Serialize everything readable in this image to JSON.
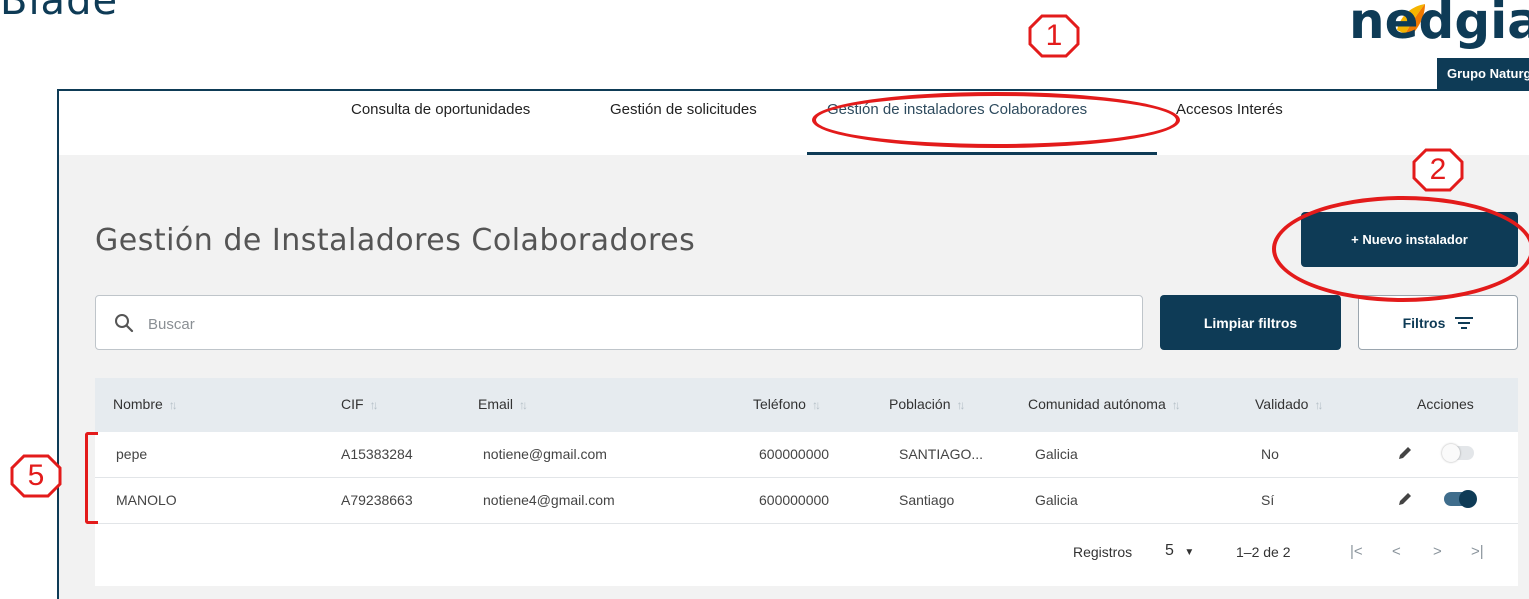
{
  "header": {
    "cut_word": "Blade"
  },
  "logo": {
    "name": "nedgia",
    "subtitle": "Grupo Naturgy",
    "colors": {
      "navy": "#0e3b56",
      "yellow": "#f5b400",
      "orange": "#f07800"
    }
  },
  "nav": {
    "items": [
      {
        "label": "Consulta de oportunidades"
      },
      {
        "label": "Gestión de solicitudes"
      },
      {
        "label": "Gestión de instaladores Colaboradores",
        "active": true
      },
      {
        "label": "Accesos Interés"
      }
    ]
  },
  "page": {
    "title": "Gestión de Instaladores Colaboradores"
  },
  "actions": {
    "new_installer": "+ Nuevo instalador",
    "clear_filters": "Limpiar filtros",
    "filters": "Filtros"
  },
  "search": {
    "placeholder": "Buscar",
    "value": ""
  },
  "table": {
    "columns": [
      "Nombre",
      "CIF",
      "Email",
      "Teléfono",
      "Población",
      "Comunidad autónoma",
      "Validado",
      "Acciones"
    ],
    "rows": [
      {
        "nombre": "pepe",
        "cif": "A15383284",
        "email": "notiene@gmail.com",
        "telefono": "600000000",
        "poblacion": "SANTIAGO...",
        "comunidad": "Galicia",
        "validado": "No",
        "activo": false
      },
      {
        "nombre": "MANOLO",
        "cif": "A79238663",
        "email": "notiene4@gmail.com",
        "telefono": "600000000",
        "poblacion": "Santiago",
        "comunidad": "Galicia",
        "validado": "Sí",
        "activo": true
      }
    ]
  },
  "pagination": {
    "label": "Registros",
    "page_size": "5",
    "range": "1–2 de 2"
  },
  "annotations": {
    "marker_1": "1",
    "marker_2": "2",
    "marker_5": "5",
    "color": "#e31b1b"
  }
}
